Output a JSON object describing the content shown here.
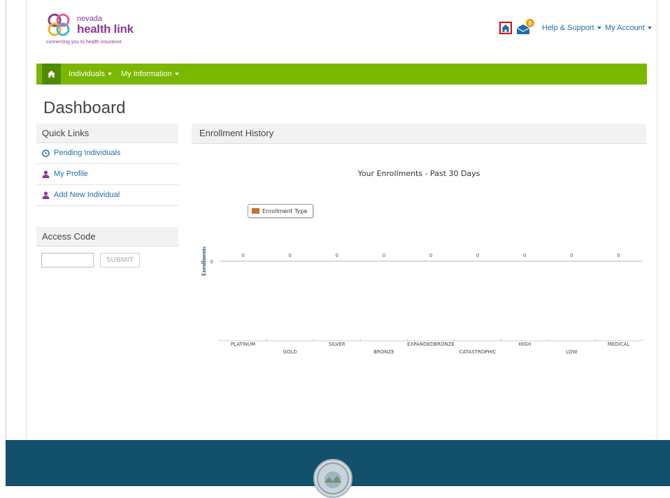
{
  "header": {
    "logo_small": "nevada",
    "logo_big": "health link",
    "tagline": "connecting you to health insurance",
    "mail_count": "0",
    "help_label": "Help & Support",
    "account_label": "My Account"
  },
  "nav": {
    "items": [
      {
        "label": "Individuals"
      },
      {
        "label": "My Information"
      }
    ]
  },
  "page_title": "Dashboard",
  "quick_links": {
    "heading": "Quick Links",
    "items": [
      {
        "label": "Pending Individuals",
        "icon": "clock-icon"
      },
      {
        "label": "My Profile",
        "icon": "user-icon"
      },
      {
        "label": "Add New Individual",
        "icon": "user-icon"
      }
    ]
  },
  "access_code": {
    "heading": "Access Code",
    "input_value": "",
    "submit_label": "SUBMIT"
  },
  "enrollment": {
    "heading": "Enrollment History"
  },
  "colors": {
    "nav_green": "#7ab800",
    "nav_home_green": "#4f8b00",
    "link_blue": "#1f6fa8",
    "purple": "#8d3a95",
    "bar_orange": "#c9702b",
    "footer_blue": "#12506c"
  },
  "chart_data": {
    "type": "bar",
    "title": "Your Enrollments - Past 30 Days",
    "ylabel": "Enrollments",
    "ytick": "0",
    "legend": {
      "placement": "top-left",
      "label": "Enrollment Type"
    },
    "categories": [
      "PLATINUM",
      "GOLD",
      "SILVER",
      "BRONZE",
      "EXPANDEDBRONZE",
      "CATASTROPHIC",
      "HIGH",
      "LOW",
      "MEDICAL"
    ],
    "series": [
      {
        "name": "Enrollment Type",
        "values": [
          0,
          0,
          0,
          0,
          0,
          0,
          0,
          0,
          0
        ]
      }
    ],
    "ylim": [
      0,
      1
    ]
  }
}
